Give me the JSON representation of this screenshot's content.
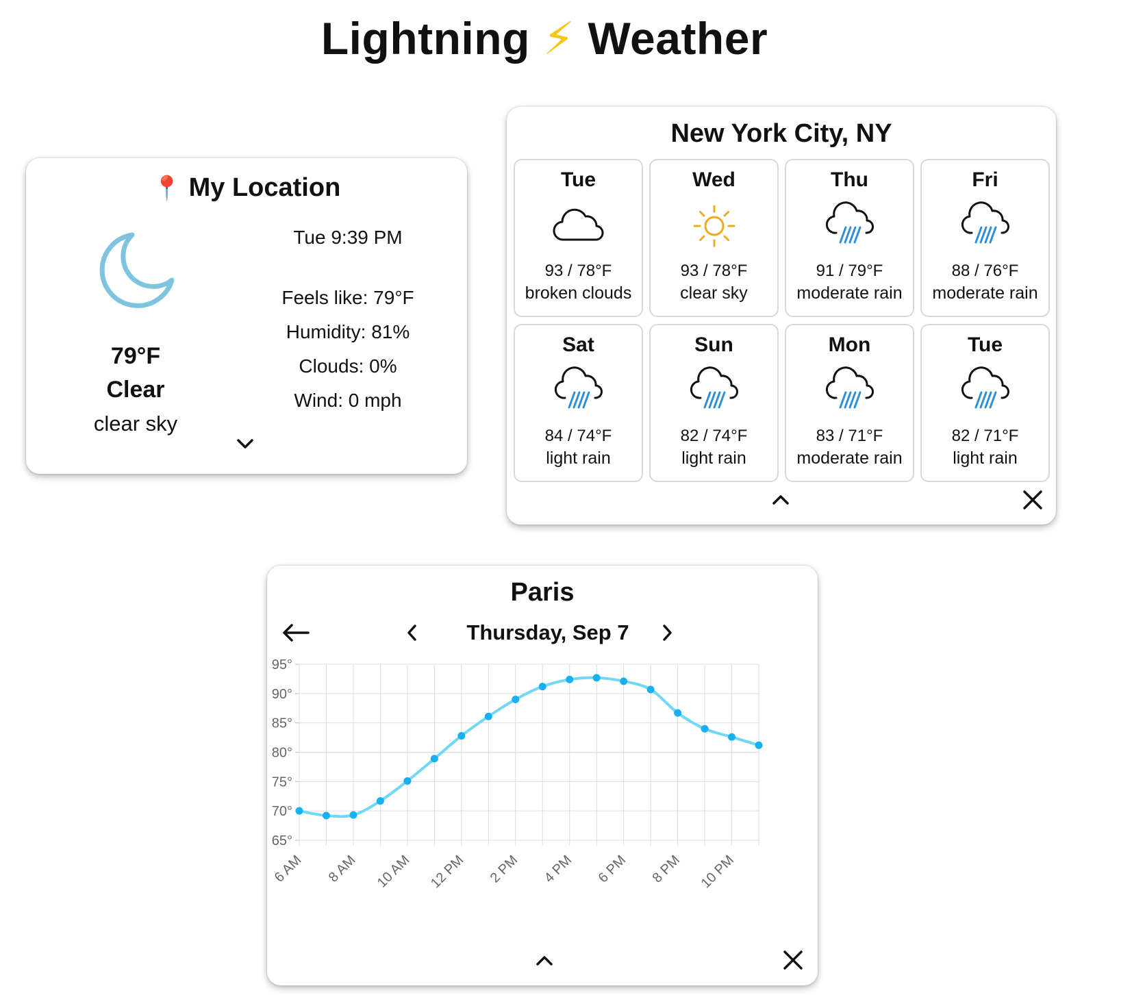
{
  "app": {
    "title_left": "Lightning",
    "title_icon": "lightning-bolt-icon",
    "title_bolt": "⚡",
    "title_right": "Weather"
  },
  "my_location": {
    "pin_icon": "map-pin-icon",
    "pin_glyph": "📍",
    "title": "My Location",
    "condition_icon": "moon-icon",
    "temperature": "79°F",
    "condition": "Clear",
    "description": "clear sky",
    "time": "Tue 9:39 PM",
    "feels_like": "Feels like: 79°F",
    "humidity": "Humidity: 81%",
    "clouds": "Clouds: 0%",
    "wind": "Wind: 0 mph",
    "expand_icon": "chevron-down-icon"
  },
  "nyc": {
    "title": "New York City, NY",
    "days": [
      {
        "day": "Tue",
        "icon": "cloud-icon",
        "temps": "93 / 78°F",
        "desc": "broken clouds"
      },
      {
        "day": "Wed",
        "icon": "sun-icon",
        "temps": "93 / 78°F",
        "desc": "clear sky"
      },
      {
        "day": "Thu",
        "icon": "rain-cloud-icon",
        "temps": "91 / 79°F",
        "desc": "moderate rain"
      },
      {
        "day": "Fri",
        "icon": "rain-cloud-icon",
        "temps": "88 / 76°F",
        "desc": "moderate rain"
      },
      {
        "day": "Sat",
        "icon": "rain-cloud-icon",
        "temps": "84 / 74°F",
        "desc": "light rain"
      },
      {
        "day": "Sun",
        "icon": "rain-cloud-icon",
        "temps": "82 / 74°F",
        "desc": "light rain"
      },
      {
        "day": "Mon",
        "icon": "rain-cloud-icon",
        "temps": "83 / 71°F",
        "desc": "moderate rain"
      },
      {
        "day": "Tue",
        "icon": "rain-cloud-icon",
        "temps": "82 / 71°F",
        "desc": "light rain"
      }
    ],
    "collapse_icon": "chevron-up-icon",
    "close_icon": "close-icon"
  },
  "paris": {
    "title": "Paris",
    "back_icon": "arrow-left-icon",
    "prev_icon": "chevron-left-icon",
    "date": "Thursday, Sep 7",
    "next_icon": "chevron-right-icon",
    "collapse_icon": "chevron-up-icon",
    "close_icon": "close-icon"
  },
  "colors": {
    "line": "#6fd8f5",
    "point": "#19b0f0",
    "moon": "#7ec4df",
    "sun": "#f0a81c",
    "rain": "#2f8fd8",
    "grid": "#dddddd"
  },
  "chart_data": {
    "type": "line",
    "title": "",
    "xlabel": "",
    "ylabel": "",
    "x": [
      "6 AM",
      "7 AM",
      "8 AM",
      "9 AM",
      "10 AM",
      "11 AM",
      "12 PM",
      "1 PM",
      "2 PM",
      "3 PM",
      "4 PM",
      "5 PM",
      "6 PM",
      "7 PM",
      "8 PM",
      "9 PM",
      "10 PM",
      "11 PM"
    ],
    "x_tick_labels": [
      "6 AM",
      "8 AM",
      "10 AM",
      "12 PM",
      "2 PM",
      "4 PM",
      "6 PM",
      "8 PM",
      "10 PM"
    ],
    "values": [
      70.0,
      69.2,
      69.3,
      71.7,
      75.1,
      78.9,
      82.8,
      86.1,
      89.0,
      91.2,
      92.4,
      92.7,
      92.1,
      90.7,
      86.7,
      84.0,
      82.6,
      81.2
    ],
    "ylim": [
      65,
      95
    ],
    "y_ticks": [
      65,
      70,
      75,
      80,
      85,
      90,
      95
    ],
    "y_tick_suffix": "°",
    "grid": true,
    "legend": "none"
  }
}
